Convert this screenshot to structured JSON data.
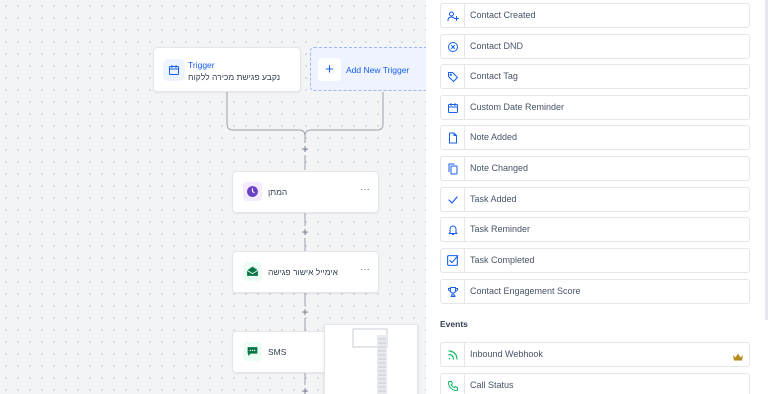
{
  "canvas": {
    "trigger": {
      "title": "Trigger",
      "subtitle": "נקבע פגישת מכירה ללקוח"
    },
    "add_trigger_label": "Add New Trigger",
    "actions": [
      {
        "label": "המתן",
        "menu": "···",
        "icon": "clock-icon",
        "color": "#6941c6"
      },
      {
        "label": "אימייל אישור פגישה",
        "menu": "···",
        "icon": "email-open-icon",
        "color": "#067647"
      },
      {
        "label": "SMS",
        "icon": "sms-icon",
        "color": "#067647"
      }
    ],
    "plus_label": "+"
  },
  "panel": {
    "triggers": [
      {
        "label": "Contact Created",
        "icon": "user-plus-icon"
      },
      {
        "label": "Contact DND",
        "icon": "circle-x-icon"
      },
      {
        "label": "Contact Tag",
        "icon": "tag-icon"
      },
      {
        "label": "Custom Date Reminder",
        "icon": "calendar-icon"
      },
      {
        "label": "Note Added",
        "icon": "file-icon"
      },
      {
        "label": "Note Changed",
        "icon": "copy-icon"
      },
      {
        "label": "Task Added",
        "icon": "check-icon"
      },
      {
        "label": "Task Reminder",
        "icon": "bell-icon"
      },
      {
        "label": "Task Completed",
        "icon": "check-square-icon"
      },
      {
        "label": "Contact Engagement Score",
        "icon": "trophy-icon"
      }
    ],
    "events_heading": "Events",
    "events": [
      {
        "label": "Inbound Webhook",
        "icon": "rss-icon",
        "premium": true,
        "badge_icon": "crown-icon"
      },
      {
        "label": "Call Status",
        "icon": "phone-icon"
      }
    ],
    "accent_color": "#155eef"
  }
}
